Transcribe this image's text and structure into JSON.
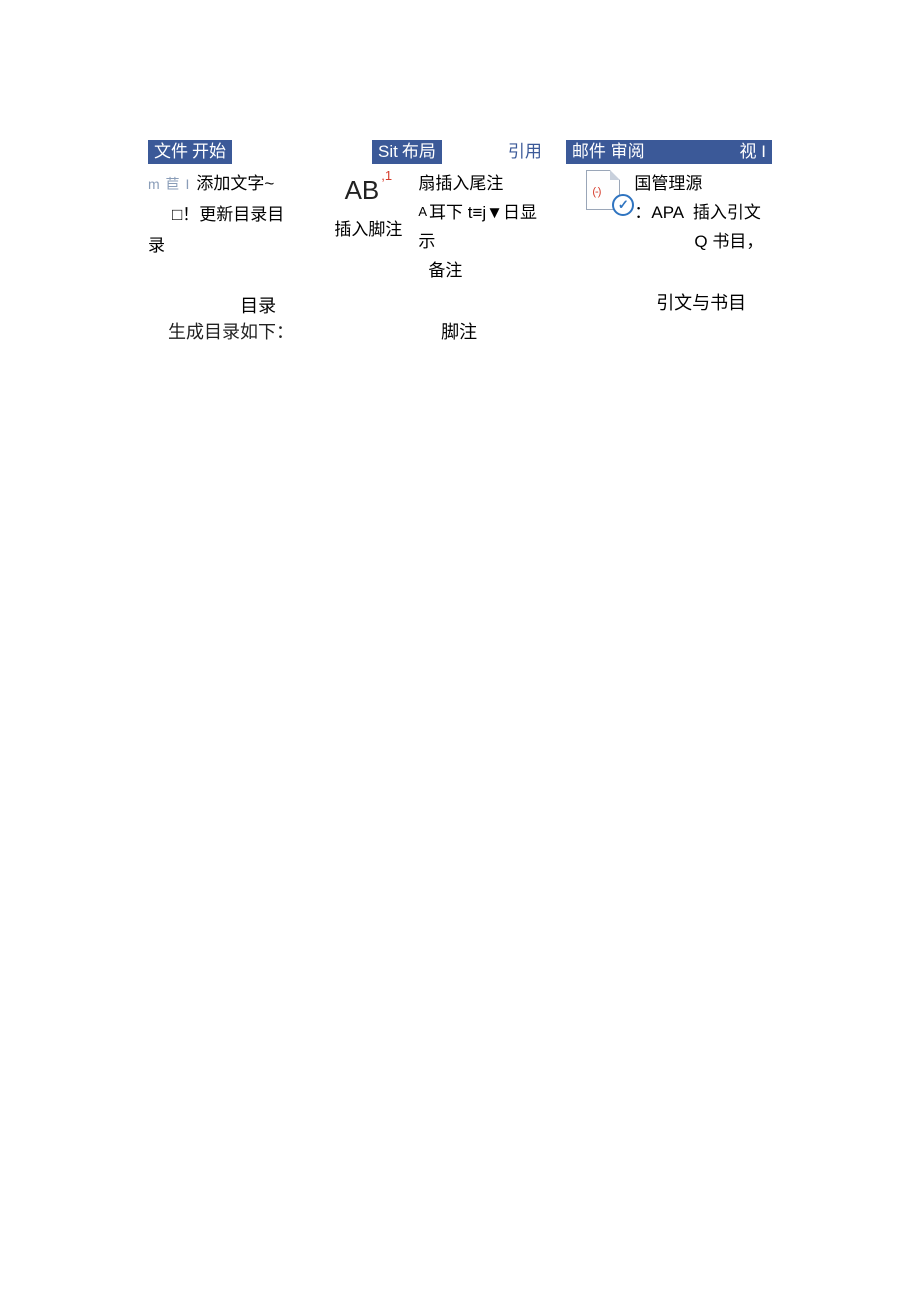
{
  "tabs": {
    "seg1a": "文件",
    "seg1b": "开始",
    "seg2a": "Sit",
    "seg2b": "布局",
    "seg3": "引用",
    "seg4a": "邮件",
    "seg4b": "审阅",
    "seg4c": "视 I"
  },
  "toc_group": {
    "prefix_muted": "m 苣 I",
    "add_text": "添加文字~",
    "update_toc": "□！更新目录目",
    "lu": "录",
    "label": "目录"
  },
  "footnote_group": {
    "ab": "AB",
    "ab_sup": ",1",
    "insert_endnote": "扇插入尾注",
    "insert_footnote": "插入脚注",
    "next_note_line": "耳下 t≡j▼日显示",
    "beizhu": "备注",
    "label": "脚注"
  },
  "citation_group": {
    "manage_sources": "国管理源",
    "style_prefix": "：",
    "style": "APA",
    "insert_citation": "插入引文",
    "biblio": "Q 书目",
    "comma": "，",
    "label": "引文与书目"
  },
  "body": {
    "text": "生成目录如下："
  }
}
